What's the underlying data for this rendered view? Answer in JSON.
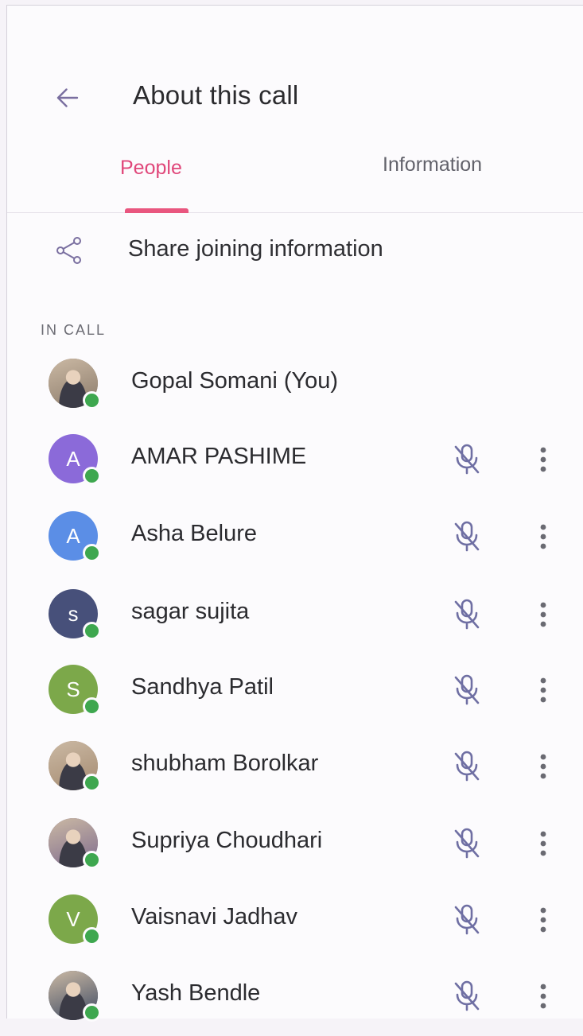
{
  "header": {
    "title": "About this call"
  },
  "tabs": [
    {
      "label": "People",
      "active": true
    },
    {
      "label": "Information",
      "active": false
    }
  ],
  "share": {
    "label": "Share joining information"
  },
  "section": {
    "label": "IN CALL"
  },
  "colors": {
    "accent": "#e0477a",
    "online": "#3ea74f"
  },
  "participants": [
    {
      "name": "Gopal Somani (You)",
      "initial": "",
      "avatar_color": "#8a7a6a",
      "photo": true,
      "muted_icon": false,
      "more": false
    },
    {
      "name": "AMAR PASHIME",
      "initial": "A",
      "avatar_color": "#8b6ad9",
      "photo": false,
      "muted_icon": true,
      "more": true
    },
    {
      "name": "Asha Belure",
      "initial": "A",
      "avatar_color": "#5b8ee6",
      "photo": false,
      "muted_icon": true,
      "more": true
    },
    {
      "name": "sagar sujita",
      "initial": "s",
      "avatar_color": "#47507a",
      "photo": false,
      "muted_icon": true,
      "more": true
    },
    {
      "name": "Sandhya Patil",
      "initial": "S",
      "avatar_color": "#7ca84a",
      "photo": false,
      "muted_icon": true,
      "more": true
    },
    {
      "name": "shubham Borolkar",
      "initial": "",
      "avatar_color": "#a48a70",
      "photo": true,
      "muted_icon": true,
      "more": true
    },
    {
      "name": "Supriya Choudhari",
      "initial": "",
      "avatar_color": "#7d6a8e",
      "photo": true,
      "muted_icon": true,
      "more": true
    },
    {
      "name": "Vaisnavi Jadhav",
      "initial": "V",
      "avatar_color": "#7ca84a",
      "photo": false,
      "muted_icon": true,
      "more": true
    },
    {
      "name": "Yash Bendle",
      "initial": "",
      "avatar_color": "#3d4a63",
      "photo": true,
      "muted_icon": true,
      "more": true
    }
  ]
}
